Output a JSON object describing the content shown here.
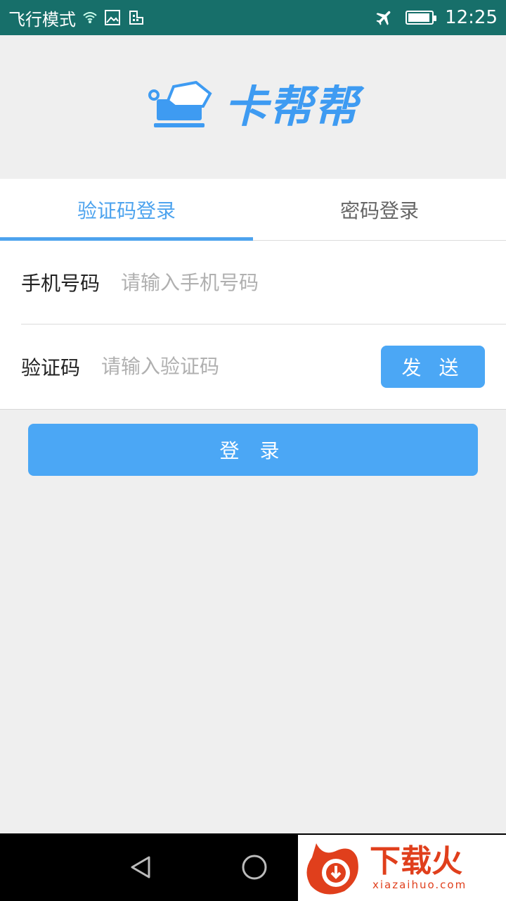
{
  "status_bar": {
    "mode_text": "飞行模式",
    "time": "12:25",
    "icons": [
      "wifi-icon",
      "image-icon",
      "sim-icon",
      "airplane-icon",
      "battery-icon"
    ]
  },
  "header": {
    "logo_text": "卡帮帮",
    "brand_color": "#3e9bf2"
  },
  "tabs": [
    {
      "label": "验证码登录",
      "active": true
    },
    {
      "label": "密码登录",
      "active": false
    }
  ],
  "form": {
    "phone": {
      "label": "手机号码",
      "placeholder": "请输入手机号码",
      "value": ""
    },
    "code": {
      "label": "验证码",
      "placeholder": "请输入验证码",
      "value": ""
    },
    "send_label": "发 送"
  },
  "login_label": "登 录",
  "nav_bar": {
    "icons": [
      "back-icon",
      "home-icon",
      "recents-icon"
    ]
  },
  "watermark": {
    "cn_text": "下载火",
    "en_text": "xiazaihuo.com",
    "color": "#e03f1c"
  },
  "colors": {
    "accent": "#4ba7f5",
    "status_bar": "#176f6a",
    "background": "#efefef"
  }
}
